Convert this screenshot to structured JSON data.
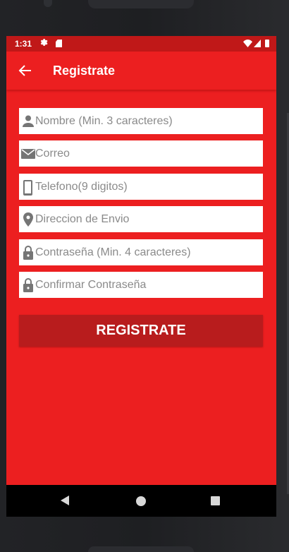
{
  "status_bar": {
    "time": "1:31",
    "icons": [
      "gear-icon",
      "sd-card-icon",
      "wifi-icon",
      "signal-icon",
      "battery-icon"
    ]
  },
  "app_bar": {
    "title": "Registrate",
    "back_icon": "arrow-back-icon"
  },
  "form": {
    "fields": [
      {
        "name": "nombre",
        "icon": "person-icon",
        "placeholder": "Nombre (Min. 3 caracteres)",
        "value": ""
      },
      {
        "name": "correo",
        "icon": "mail-icon",
        "placeholder": "Correo",
        "value": ""
      },
      {
        "name": "telefono",
        "icon": "phone-icon",
        "placeholder": "Telefono(9 digitos)",
        "value": ""
      },
      {
        "name": "direccion",
        "icon": "location-pin-icon",
        "placeholder": "Direccion de Envio",
        "value": ""
      },
      {
        "name": "contrasena",
        "icon": "lock-icon",
        "placeholder": "Contraseña (Min. 4 caracteres)",
        "value": ""
      },
      {
        "name": "confirmar",
        "icon": "lock-icon",
        "placeholder": "Confirmar Contraseña",
        "value": ""
      }
    ],
    "submit_label": "REGISTRATE"
  },
  "nav_bar": {
    "icons": [
      "nav-back-icon",
      "nav-home-icon",
      "nav-recents-icon"
    ]
  },
  "colors": {
    "primary": "#ec1f20",
    "status_bar": "#c01818",
    "button": "#b81c1d",
    "field_bg": "#ffffff",
    "icon_gray": "#757575"
  }
}
